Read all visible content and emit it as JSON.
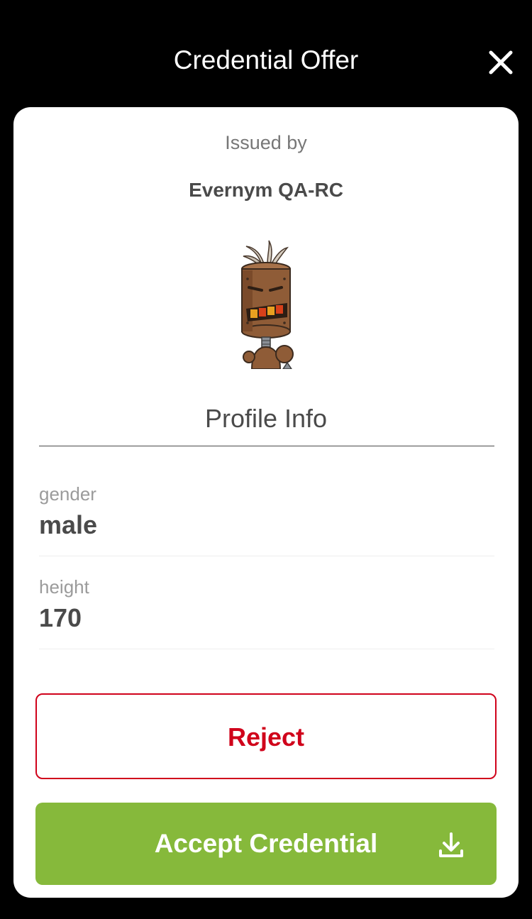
{
  "header": {
    "title": "Credential Offer",
    "close_icon": "close-icon"
  },
  "offer": {
    "issued_by_label": "Issued by",
    "issuer_name": "Evernym QA-RC",
    "issuer_avatar": "robot-avatar",
    "credential_name": "Profile Info",
    "attributes": [
      {
        "label": "gender",
        "value": "male"
      },
      {
        "label": "height",
        "value": "170"
      }
    ]
  },
  "actions": {
    "reject_label": "Reject",
    "accept_label": "Accept Credential",
    "accept_icon": "download-icon"
  },
  "colors": {
    "background": "#000000",
    "card": "#ffffff",
    "reject": "#d0021b",
    "accept": "#86b93b"
  }
}
